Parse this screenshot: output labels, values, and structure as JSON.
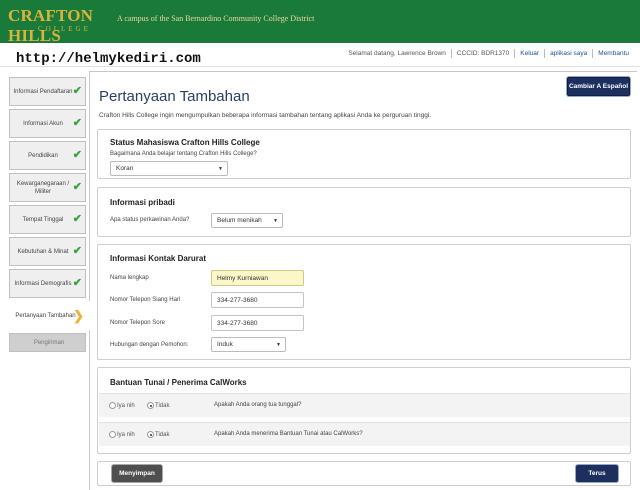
{
  "header": {
    "logo_text": "CRAFTON HILLS",
    "logo_sub": "COLLEGE",
    "tagline": "A campus of the San Bernardino Community College District",
    "brand_color": "#1a7a3a"
  },
  "watermark": "http://helmykediri.com",
  "user_nav": {
    "welcome": "Selamat datang, Lawrence Brown",
    "cccid": "CCCID: BDR1370",
    "logout": "Keluar",
    "my_apps": "aplikasi saya",
    "help": "Membantu"
  },
  "sidebar": {
    "steps": [
      {
        "label": "Informasi Pendaftaran",
        "status": "complete"
      },
      {
        "label": "Informasi Akun",
        "status": "complete"
      },
      {
        "label": "Pendidikan",
        "status": "complete"
      },
      {
        "label": "Kewarganegaraan / Militer",
        "status": "complete"
      },
      {
        "label": "Tempat Tinggal",
        "status": "complete"
      },
      {
        "label": "Kebutuhan & Minat",
        "status": "complete"
      },
      {
        "label": "Informasi Demografis",
        "status": "complete"
      },
      {
        "label": "Pertanyaan Tambahan",
        "status": "current"
      },
      {
        "label": "Pengiriman",
        "status": "pending"
      }
    ],
    "check_icon": "check-icon",
    "current_icon": "chevron-right-icon"
  },
  "main": {
    "lang_button": "Cambiar A Español",
    "title": "Pertanyaan Tambahan",
    "intro": "Crafton Hills College ingin mengumpulkan beberapa informasi tambahan tentang aplikasi Anda ke perguruan tinggi.",
    "status_section": {
      "heading": "Status Mahasiswa Crafton Hills College",
      "question": "Bagaimana Anda belajar tentang Crafton Hills College?",
      "selected": "Koran"
    },
    "personal_section": {
      "heading": "Informasi pribadi",
      "marital_label": "Apa status perkawinan Anda?",
      "marital_value": "Belum menikah"
    },
    "emergency_section": {
      "heading": "Informasi Kontak Darurat",
      "full_name_label": "Nama lengkap",
      "full_name_value": "Helmy Kurniawan",
      "day_phone_label": "Nomor Telepon Siang Hari",
      "day_phone_value": "334-277-3680",
      "evening_phone_label": "Nomor Telepon Sore",
      "evening_phone_value": "334-277-3680",
      "relationship_label": "Hubungan dengan Pemohon:",
      "relationship_value": "Induk"
    },
    "calworks_section": {
      "heading": "Bantuan Tunai / Penerima CalWorks",
      "yes_label": "Iya nih",
      "no_label": "Tidak",
      "q1": "Apakah Anda orang tua tunggal?",
      "q1_answer": "Tidak",
      "q2": "Apakah Anda menerima Bantuan Tunai atau CalWorks?",
      "q2_answer": "Tidak"
    },
    "save_button": "Menyimpan",
    "next_button": "Terus"
  }
}
